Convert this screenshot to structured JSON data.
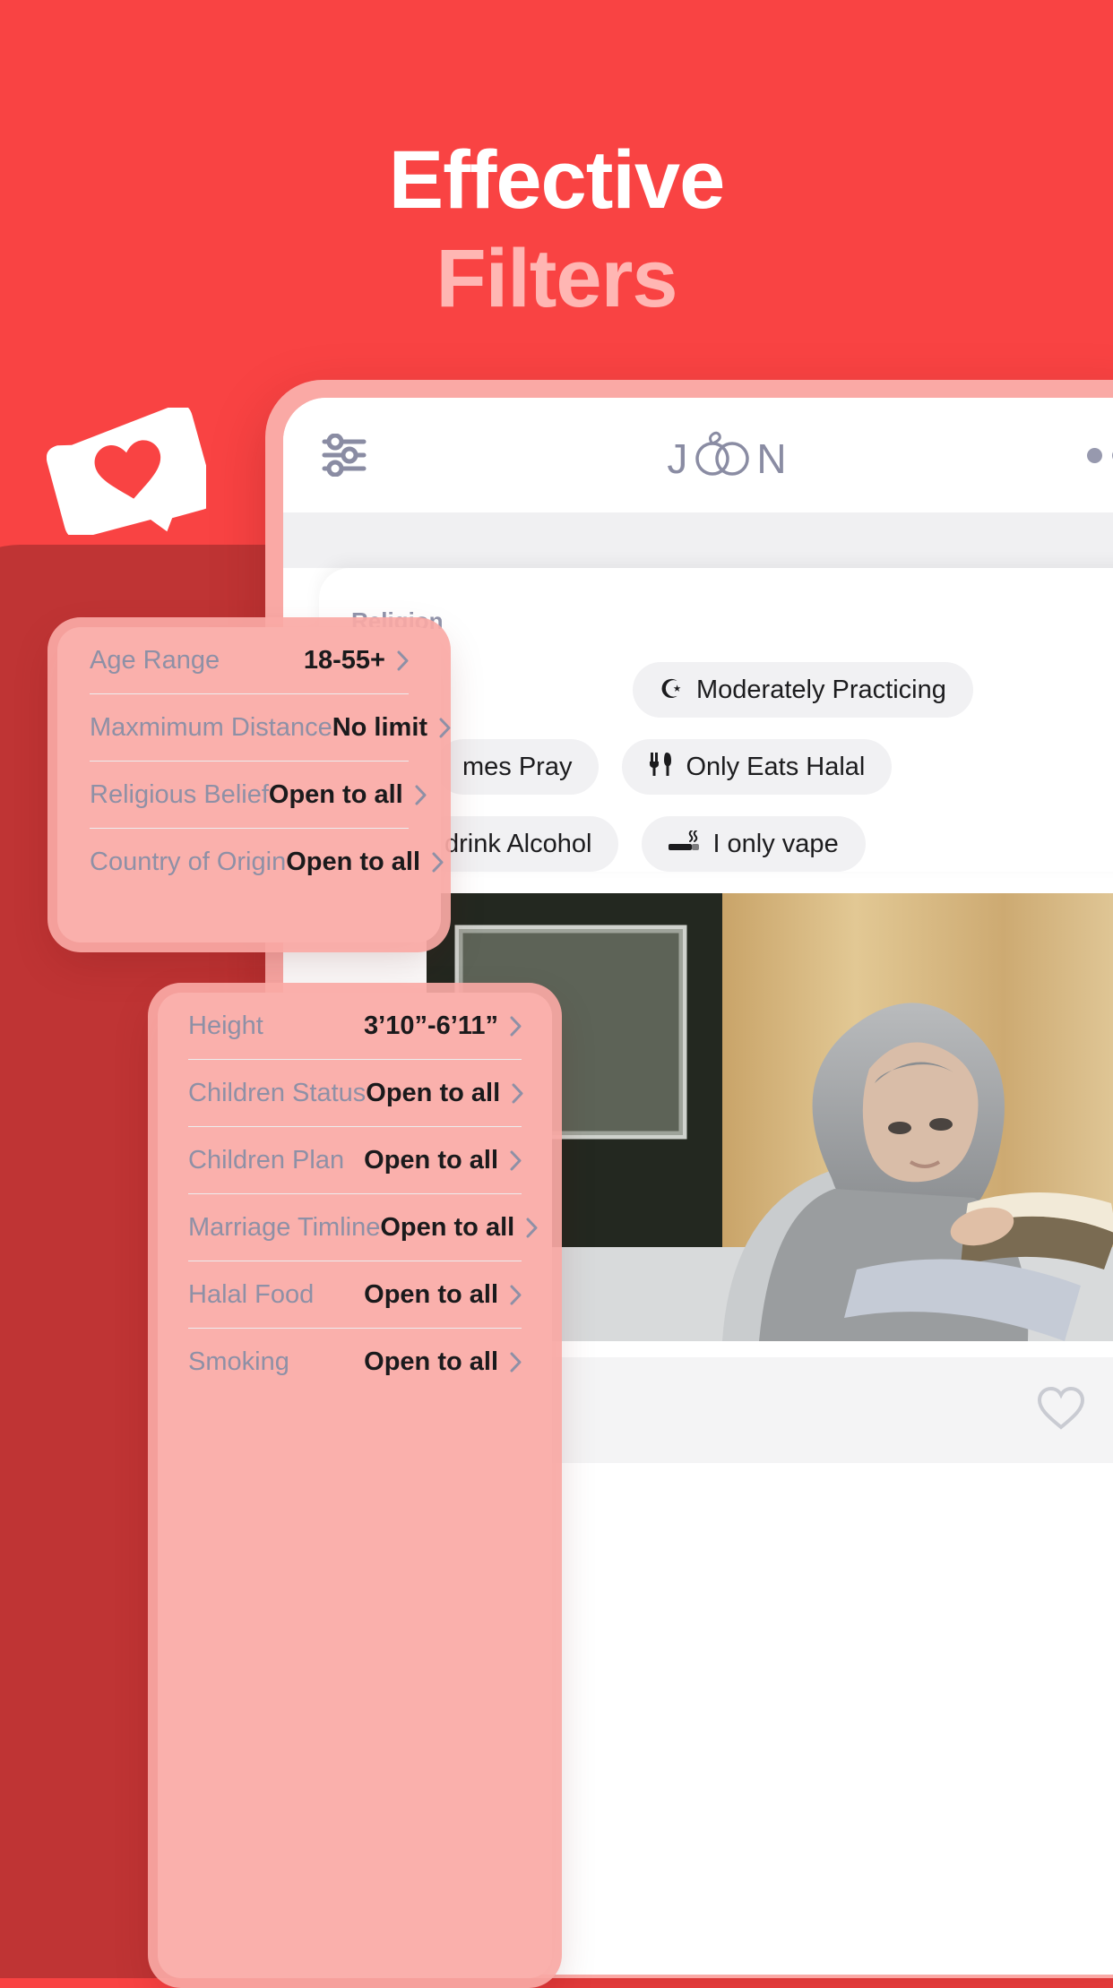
{
  "hero": {
    "line1": "Effective",
    "line2": "Filters",
    "line1_color": "#FFFFFF",
    "line2_color": "#FFB6B3",
    "background_color": "#F94343"
  },
  "brand": {
    "wordmark": "JOON",
    "logo_icon": "joon-interlocking-rings-logo",
    "accent_color": "#F94343",
    "backdrop_color": "#BF3434",
    "phone_frame_color": "#FAA9A5"
  },
  "badge": {
    "icon": "heart-sticker-icon"
  },
  "app_header": {
    "filters_icon": "sliders-icon",
    "overflow_icon": "more-horizontal-icon"
  },
  "filter_sheet": {
    "section_label": "Religion",
    "chip_rows": [
      [
        {
          "icon": "star-and-crescent-icon",
          "glyph": "☪",
          "label": "Moderately Practicing"
        }
      ],
      [
        {
          "icon": "prayer-icon",
          "glyph": "",
          "label": "mes Pray"
        },
        {
          "icon": "fork-and-knife-icon",
          "glyph": "🍴",
          "label": "Only Eats Halal"
        }
      ],
      [
        {
          "icon": "glass-icon",
          "glyph": "",
          "label": "drink Alcohol"
        },
        {
          "icon": "cigarette-icon",
          "glyph": "🚬",
          "label": "I only vape"
        }
      ]
    ]
  },
  "like_bar": {
    "icon": "heart-outline-icon"
  },
  "card_top": {
    "rows": [
      {
        "label": "Age Range",
        "value": "18-55+",
        "chevron": "chevron-right-icon"
      },
      {
        "label": "Maxmimum Distance",
        "value": "No limit",
        "chevron": "chevron-right-icon"
      },
      {
        "label": "Religious Belief",
        "value": "Open to all",
        "chevron": "chevron-right-icon"
      },
      {
        "label": "Country of Origin",
        "value": "Open to all",
        "chevron": "chevron-right-icon"
      }
    ]
  },
  "card_bottom": {
    "rows": [
      {
        "label": "Height",
        "value": "3’10”-6’11”",
        "chevron": "chevron-right-icon"
      },
      {
        "label": "Children Status",
        "value": "Open to all",
        "chevron": "chevron-right-icon"
      },
      {
        "label": "Children Plan",
        "value": "Open to all",
        "chevron": "chevron-right-icon"
      },
      {
        "label": "Marriage Timline",
        "value": "Open to all",
        "chevron": "chevron-right-icon"
      },
      {
        "label": "Halal Food",
        "value": "Open to all",
        "chevron": "chevron-right-icon"
      },
      {
        "label": "Smoking",
        "value": "Open to all",
        "chevron": "chevron-right-icon"
      }
    ]
  }
}
